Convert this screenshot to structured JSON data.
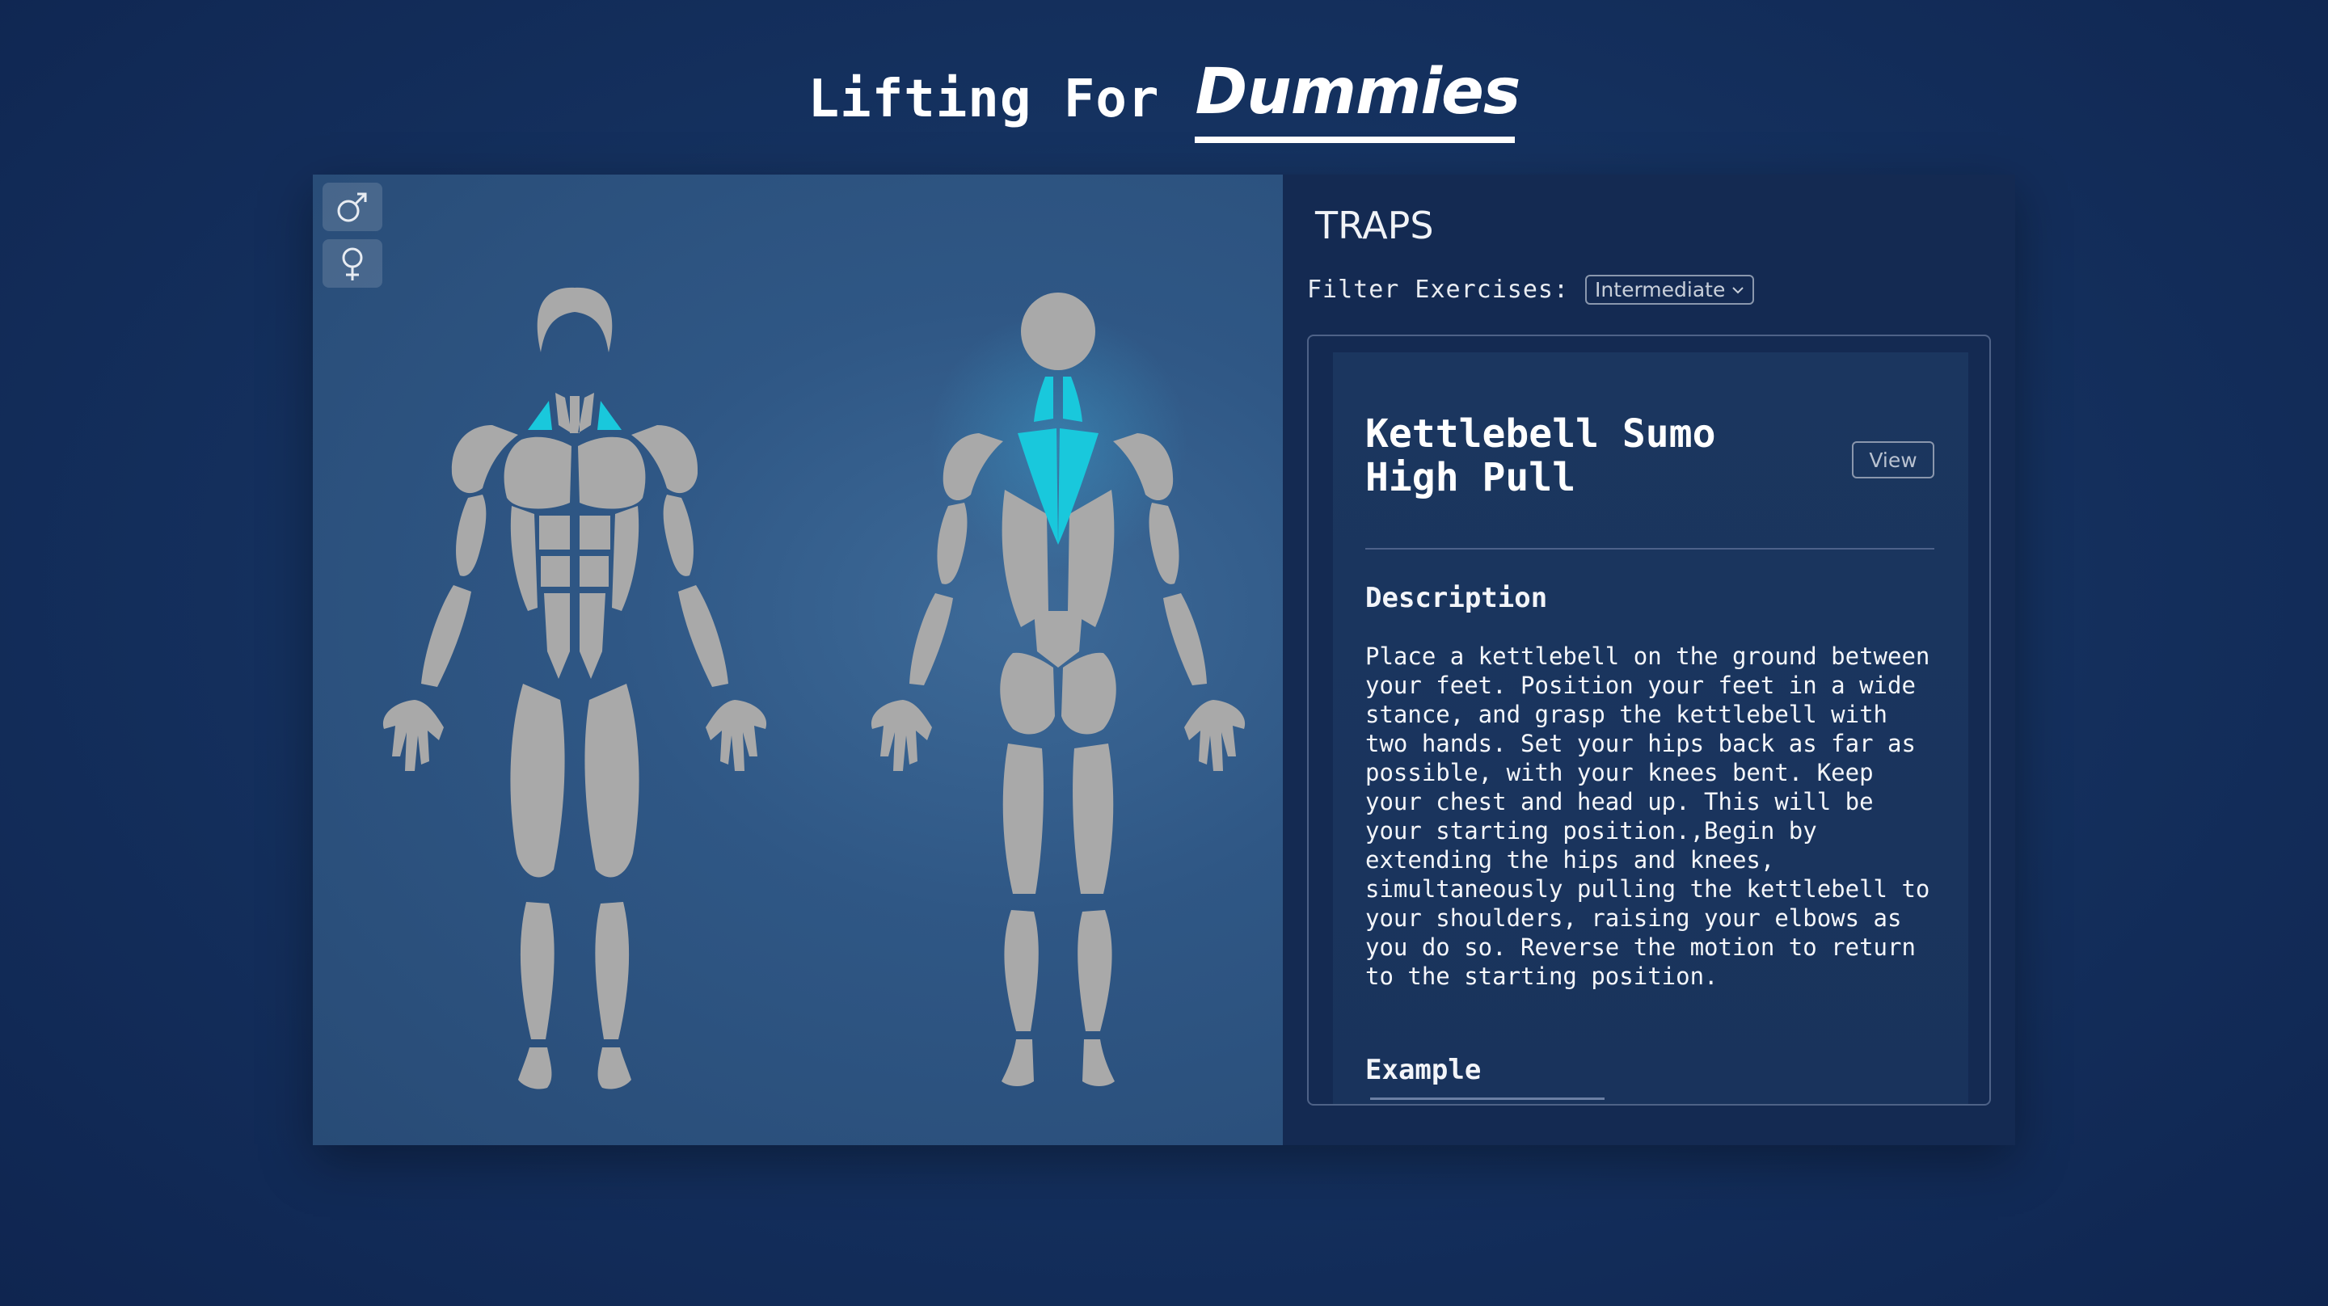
{
  "header": {
    "title_main": "Lifting For",
    "title_accent": "Dummies"
  },
  "sidebar_toggle": {
    "male_icon": "male-symbol-icon",
    "female_icon": "female-symbol-icon"
  },
  "anatomy": {
    "highlight_color": "#19c8dc",
    "muscle_color": "#a9a9a9"
  },
  "info": {
    "muscle_name": "TRAPS",
    "filter_label": "Filter Exercises:",
    "filter_value": "Intermediate",
    "exercise": {
      "title": "Kettlebell Sumo High Pull",
      "view_label": "View",
      "description_heading": "Description",
      "description": "Place a kettlebell on the ground between your feet. Position your feet in a wide stance, and grasp the kettlebell with two hands. Set your hips back as far as possible, with your knees bent. Keep your chest and head up. This will be your starting position.,Begin by extending the hips and knees, simultaneously pulling the kettlebell to your shoulders, raising your elbows as you do so. Reverse the motion to return to the starting position.",
      "example_heading": "Example"
    }
  }
}
